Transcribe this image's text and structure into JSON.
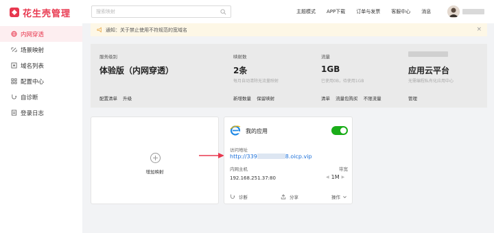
{
  "app": {
    "name": "花生壳管理"
  },
  "sidebar": {
    "items": [
      {
        "label": "内网穿透",
        "icon": "globe-icon",
        "active": true
      },
      {
        "label": "场景映射",
        "icon": "scene-icon"
      },
      {
        "label": "域名列表",
        "icon": "domain-icon"
      },
      {
        "label": "配置中心",
        "icon": "grid-icon"
      },
      {
        "label": "自诊断",
        "icon": "diagnose-icon"
      },
      {
        "label": "登录日志",
        "icon": "log-icon"
      }
    ]
  },
  "header": {
    "search_placeholder": "搜索映射",
    "links": [
      "主题模式",
      "APP下载",
      "订单与发票",
      "客服中心",
      "消息"
    ]
  },
  "notice": {
    "text": "通知：关于禁止使用不符规范的宽域名",
    "icon": "bell-icon"
  },
  "info": {
    "service": {
      "label": "服务级别",
      "value": "体验版（内网穿透）",
      "links": [
        "配置清单",
        "升级"
      ]
    },
    "mappings": {
      "label": "映射数",
      "value": "2条",
      "sub": "每月自动清除无流量映射",
      "links": [
        "新增数量",
        "保留映射"
      ]
    },
    "traffic": {
      "label": "流量",
      "value": "1GB",
      "sub": "已使用0B，待使用1GB",
      "links": [
        "清单",
        "流量包购买",
        "不限流量"
      ]
    },
    "cloud": {
      "value": "应用云平台",
      "sub": "无需编程私有化应用中心",
      "links": [
        "管理"
      ]
    }
  },
  "add_card": {
    "label": "增加映射"
  },
  "app_card": {
    "name": "我的应用",
    "enabled": true,
    "access_label": "访问地址",
    "url_prefix": "http://339",
    "url_suffix": "8.oicp.vip",
    "host_label": "内网主机",
    "host": "192.168.251.37:80",
    "bandwidth_label": "带宽",
    "bandwidth": "1M",
    "footer": {
      "diagnose": "诊断",
      "share": "分享",
      "actions": "操作"
    }
  },
  "colors": {
    "brand": "#e8384f",
    "toggle": "#1aad19",
    "link": "#1a6fd9"
  }
}
